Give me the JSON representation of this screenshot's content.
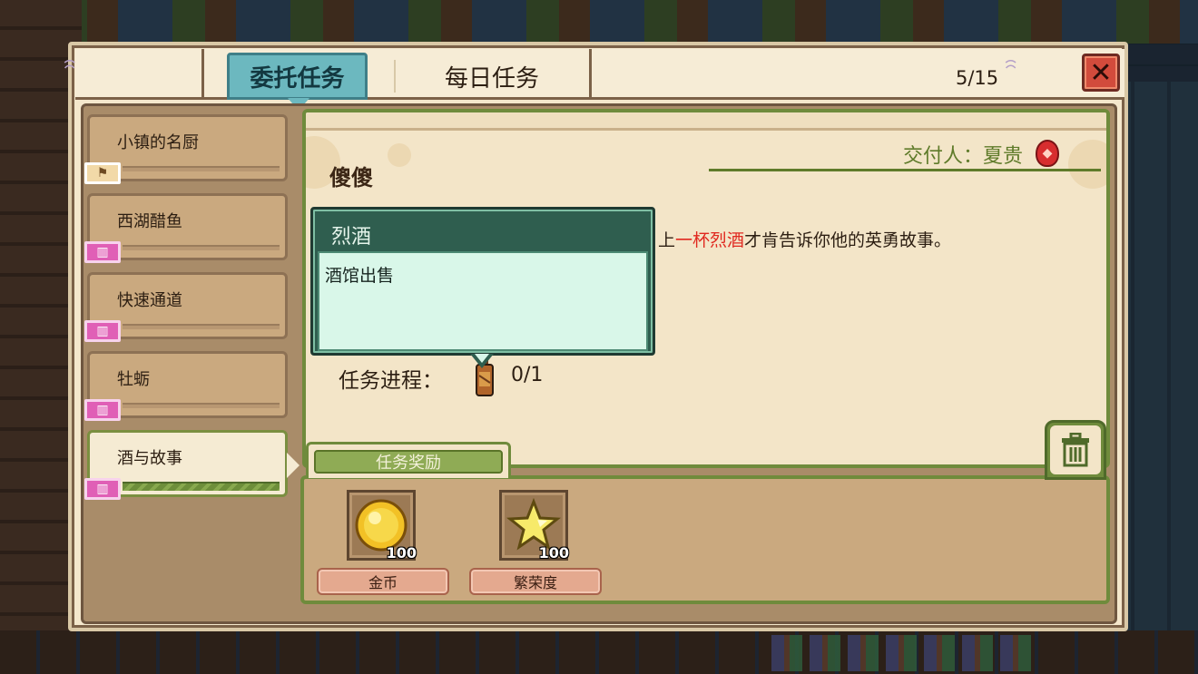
{
  "header": {
    "tab_commission": "委托任务",
    "tab_daily": "每日任务",
    "count": "5/15",
    "close_icon": "close-icon"
  },
  "quests": [
    {
      "label": "小镇的名厨",
      "badge": "flag-icon",
      "active": false
    },
    {
      "label": "西湖醋鱼",
      "badge": "building-icon",
      "active": false
    },
    {
      "label": "快速通道",
      "badge": "building-icon",
      "active": false
    },
    {
      "label": "牡蛎",
      "badge": "building-icon",
      "active": false
    },
    {
      "label": "酒与故事",
      "badge": "building-icon",
      "active": true
    }
  ],
  "detail": {
    "giver": "交付人：夏贵",
    "title": "傻傻",
    "description_pre": "上",
    "description_highlight": "一杯烈酒",
    "description_post": "才肯告诉你他的英勇故事。",
    "progress_label": "任务进程：",
    "progress_value": "0/1"
  },
  "tooltip": {
    "title": "烈酒",
    "body": "酒馆出售"
  },
  "rewards": {
    "tab_label": "任务奖励",
    "items": [
      {
        "name": "金币",
        "qty": "100",
        "icon": "gold-coin-icon"
      },
      {
        "name": "繁荣度",
        "qty": "100",
        "icon": "star-icon"
      }
    ]
  },
  "colors": {
    "accent_tab": "#6cb8bf",
    "highlight_text": "#e0281f",
    "giver_text": "#5f7b2a",
    "close_button": "#d24b3c"
  }
}
